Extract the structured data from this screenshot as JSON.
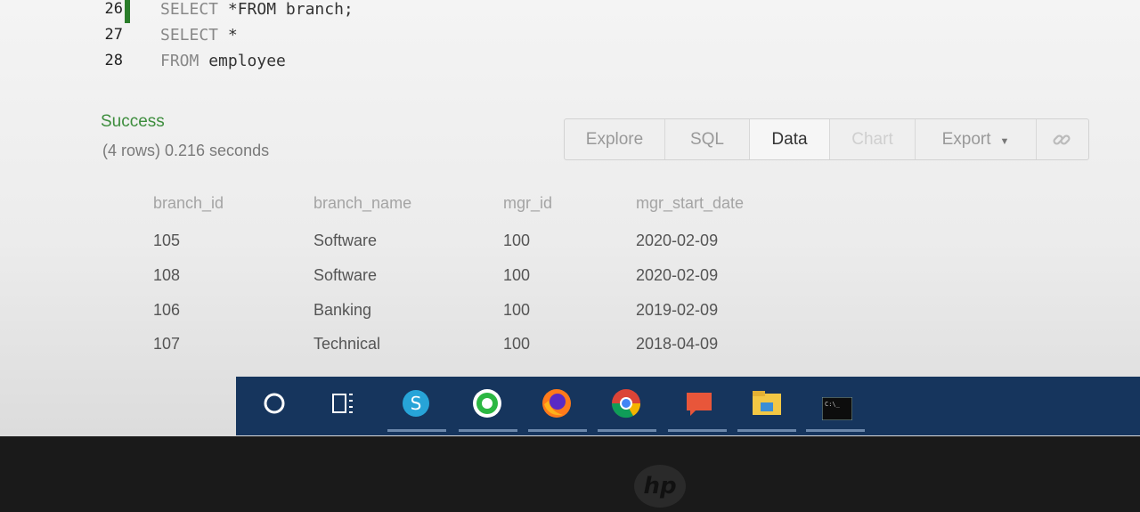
{
  "editor": {
    "lines": [
      {
        "num": "26",
        "keyword": "SELECT",
        "text": " *FROM branch;"
      },
      {
        "num": "27",
        "keyword": "SELECT",
        "text": " *"
      },
      {
        "num": "28",
        "keyword": "FROM",
        "text": " employee"
      }
    ]
  },
  "result": {
    "status": "Success",
    "summary": "(4 rows) 0.216 seconds"
  },
  "toolbar": {
    "explore": "Explore",
    "sql": "SQL",
    "data": "Data",
    "chart": "Chart",
    "export": "Export"
  },
  "table": {
    "headers": [
      "branch_id",
      "branch_name",
      "mgr_id",
      "mgr_start_date"
    ],
    "rows": [
      [
        "105",
        "Software",
        "100",
        "2020-02-09"
      ],
      [
        "108",
        "Software",
        "100",
        "2020-02-09"
      ],
      [
        "106",
        "Banking",
        "100",
        "2019-02-09"
      ],
      [
        "107",
        "Technical",
        "100",
        "2018-04-09"
      ]
    ]
  },
  "taskbar": {
    "icons": [
      "cortana-icon",
      "task-view-icon",
      "skype-icon",
      "whatsapp-icon",
      "firefox-icon",
      "chrome-icon",
      "powerpoint-icon",
      "file-explorer-icon",
      "terminal-icon"
    ]
  },
  "bezel": {
    "logo": "hp"
  },
  "colors": {
    "success": "#3d8d3d",
    "taskbar": "#16355d"
  }
}
